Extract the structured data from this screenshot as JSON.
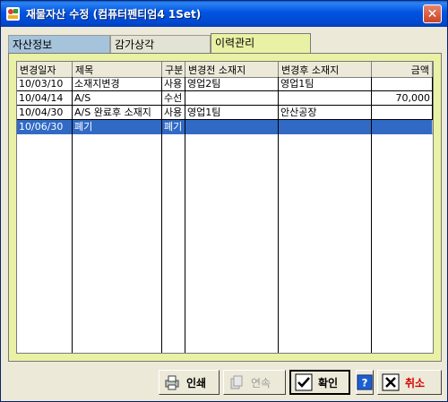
{
  "window": {
    "title": "재물자산 수정 (컴퓨터펜티엄4 1Set)",
    "close_symbol": "✕"
  },
  "tabs": [
    {
      "label": "자산정보",
      "active": false
    },
    {
      "label": "감가상각",
      "active": false
    },
    {
      "label": "이력관리",
      "active": true
    }
  ],
  "table": {
    "columns": [
      "변경일자",
      "제목",
      "구분",
      "변경전 소재지",
      "변경후 소재지",
      "금액"
    ],
    "rows": [
      [
        "10/03/10",
        "소재지변경",
        "사용",
        "영업2팀",
        "영업1팀",
        ""
      ],
      [
        "10/04/14",
        "A/S",
        "수선",
        "",
        "",
        "70,000"
      ],
      [
        "10/04/30",
        "A/S 완료후 소재지",
        "사용",
        "영업1팀",
        "안산공장",
        ""
      ],
      [
        "10/06/30",
        "폐기",
        "폐기",
        "",
        "",
        ""
      ]
    ],
    "selected_row": 3
  },
  "buttons": {
    "print": "인쇄",
    "continuous": "연속",
    "confirm": "확인",
    "help": "?",
    "cancel": "취소"
  },
  "icons": {
    "app": "app-icon",
    "print": "printer-icon",
    "continuous": "document-icon",
    "confirm": "checkmark-icon",
    "help": "help-icon",
    "cancel": "x-icon"
  },
  "colors": {
    "titlebar": "#0053e1",
    "panel": "#e9f1a4",
    "selection": "#316ac5",
    "cancel_text": "#d40000"
  }
}
